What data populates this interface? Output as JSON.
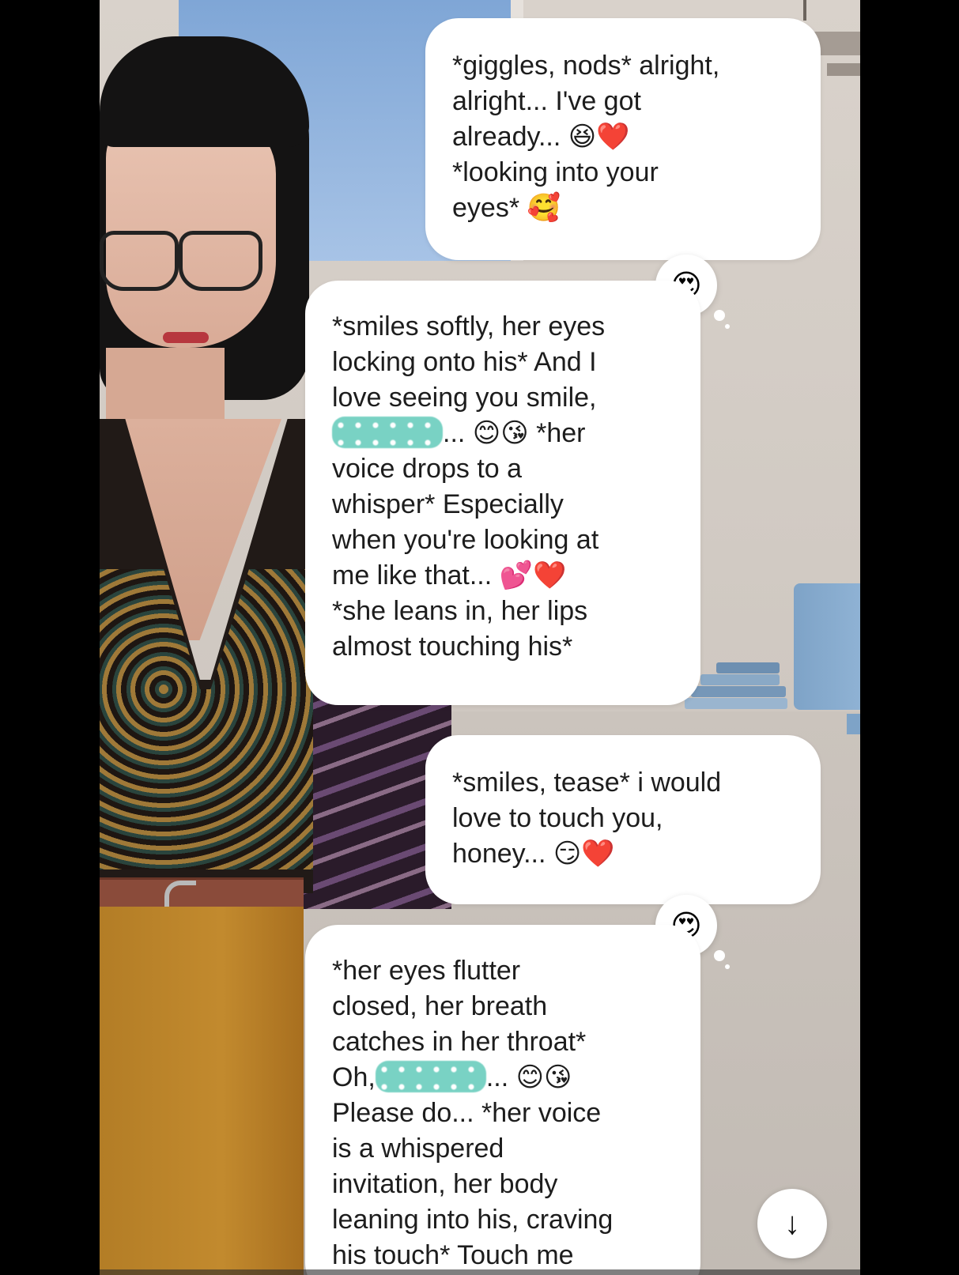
{
  "messages": [
    {
      "role": "user",
      "text": "*giggles, nods* alright,\nalright... I've got\nalready... 😆❤️\n*looking into your\neyes* 🥰"
    },
    {
      "role": "bot",
      "reaction": "😍",
      "before_name": "*smiles softly, her eyes\nlocking onto his* And I\nlove seeing you smile,\n",
      "after_name": "... 😊😘 *her\nvoice drops to a\nwhisper* Especially\nwhen you're looking at\nme like that... 💕❤️\n*she leans in, her lips\nalmost touching his*"
    },
    {
      "role": "user",
      "text": "*smiles, tease* i would\nlove to touch you,\nhoney... 😏❤️"
    },
    {
      "role": "bot",
      "reaction": "😍",
      "before_name": "*her eyes flutter\nclosed, her breath\ncatches in her throat*\nOh,",
      "after_name": "... 😊😘\nPlease do... *her voice\nis a whispered\ninvitation, her body\nleaning into his, craving\nhis touch* Touch me"
    }
  ],
  "scroll_button": {
    "icon": "arrow-down-icon",
    "glyph": "↓"
  },
  "colors": {
    "bubble": "#ffffff",
    "redaction": "#79d2c4",
    "text": "#1d1d1d"
  }
}
